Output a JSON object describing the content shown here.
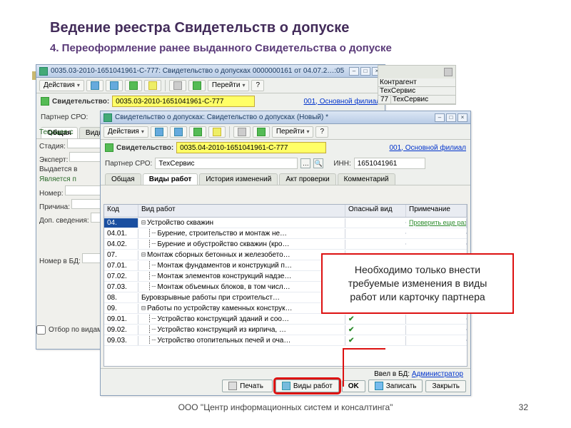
{
  "slide": {
    "title": "Ведение реестра Свидетельств о допуске",
    "subtitle": "4. Переоформление ранее выданного Свидетельства о допуске",
    "footer": "ООО \"Центр информационных систем и консалтинга\"",
    "page": "32"
  },
  "callout": "Необходимо только внести требуемые изменения в виды работ или карточку партнера",
  "win1": {
    "title": "0035.03-2010-1651041961-С-777: Свидетельство о допусках 0000000161 от 04.07.2…:05",
    "actions_label": "Действия",
    "goto_label": "Перейти",
    "cert_label": "Свидетельство:",
    "cert_value": "0035.03-2010-1651041961-С-777",
    "branch": "001, Основной филиал",
    "partner_label": "Партнер СРО:",
    "tabs": {
      "general": "Общая",
      "works": "Виды"
    },
    "side": {
      "group1": "Текущее с",
      "stage": "Стадия:",
      "expert": "Эксперт:",
      "issued": "Выдается в",
      "group2": "Является п",
      "number": "Номер:",
      "reason": "Причина:",
      "extra": "Доп. сведения:",
      "dbnum": "Номер в БД:"
    },
    "filter_label": "Отбор по видам ра"
  },
  "win2": {
    "title": "Свидетельство о допусках: Свидетельство о допусках (Новый) *",
    "actions_label": "Действия",
    "goto_label": "Перейти",
    "cert_label": "Свидетельство:",
    "cert_value": "0035.04-2010-1651041961-С-777",
    "branch": "001, Основной филиал",
    "partner_label": "Партнер СРО:",
    "partner_value": "ТехСервис",
    "inn_label": "ИНН:",
    "inn_value": "1651041961",
    "tabs": {
      "general": "Общая",
      "works": "Виды работ",
      "history": "История изменений",
      "act": "Акт проверки",
      "comment": "Комментарий"
    },
    "columns": {
      "code": "Код",
      "work": "Вид работ",
      "danger": "Опасный вид",
      "note": "Примечание"
    },
    "table_note": "Проверить еще раз!!!",
    "rows": [
      {
        "code": "04.",
        "work": "Устройство скважин",
        "lvl": 0,
        "exp": "⊟",
        "note": true
      },
      {
        "code": "04.01.",
        "work": "Бурение, строительство и монтаж не…",
        "lvl": 1
      },
      {
        "code": "04.02.",
        "work": "Бурение и обустройство скважин (кро…",
        "lvl": 1
      },
      {
        "code": "07.",
        "work": "Монтаж сборных бетонных и железобето…",
        "lvl": 0,
        "exp": "⊟"
      },
      {
        "code": "07.01.",
        "work": "Монтаж фундаментов и конструкций п…",
        "lvl": 1,
        "dang": true
      },
      {
        "code": "07.02.",
        "work": "Монтаж элементов конструкций надзе…",
        "lvl": 1,
        "dang": true
      },
      {
        "code": "07.03.",
        "work": "Монтаж объемных блоков, в том числ…",
        "lvl": 1,
        "dang": true
      },
      {
        "code": "08.",
        "work": "Буровзрывные работы при строительст…",
        "lvl": 0,
        "dang": true
      },
      {
        "code": "09.",
        "work": "Работы по устройству каменных конструк…",
        "lvl": 0,
        "exp": "⊟"
      },
      {
        "code": "09.01.",
        "work": "Устройство конструкций зданий и соо…",
        "lvl": 1,
        "dang": true
      },
      {
        "code": "09.02.",
        "work": "Устройство конструкций из кирпича, …",
        "lvl": 1,
        "dang": true
      },
      {
        "code": "09.03.",
        "work": "Устройство отопительных печей и оча…",
        "lvl": 1,
        "dang": true
      }
    ],
    "footer": {
      "db_label": "Ввел в БД:",
      "db_user": "Администратор",
      "print": "Печать",
      "works": "Виды работ",
      "ok": "OK",
      "save": "Записать",
      "close": "Закрыть"
    }
  },
  "rightpanel": {
    "h1": "Контрагент",
    "h2": "ТехСервис",
    "row_code": "77",
    "row_name": "ТехСервис"
  }
}
